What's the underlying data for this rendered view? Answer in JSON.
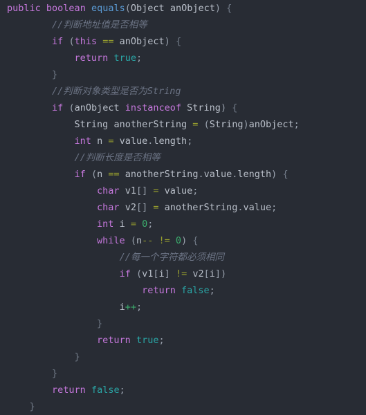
{
  "editor": {
    "language": "Java",
    "background_color": "#282c34",
    "font_size_px": 13.5,
    "line_height_px": 24,
    "theme_colors": {
      "keyword": "#c678dd",
      "function": "#5b9bd5",
      "identifier": "#b9bfc9",
      "operator": "#99a02e",
      "number": "#3cae6e",
      "literal": "#2aa6a6",
      "comment": "#6b7384",
      "brace": "#6f7885"
    },
    "lines": [
      {
        "index": 1,
        "text": "public boolean equals(Object anObject) {",
        "tokens": [
          {
            "t": "public",
            "c": "t-kw"
          },
          {
            "t": " ",
            "c": "t-plain"
          },
          {
            "t": "boolean",
            "c": "t-kw"
          },
          {
            "t": " ",
            "c": "t-plain"
          },
          {
            "t": "equals",
            "c": "t-fn"
          },
          {
            "t": "(",
            "c": "t-punc"
          },
          {
            "t": "Object",
            "c": "t-type"
          },
          {
            "t": " ",
            "c": "t-plain"
          },
          {
            "t": "anObject",
            "c": "t-id"
          },
          {
            "t": ")",
            "c": "t-punc"
          },
          {
            "t": " ",
            "c": "t-plain"
          },
          {
            "t": "{",
            "c": "t-brace"
          }
        ]
      },
      {
        "index": 2,
        "text": "        //判断地址值是否相等",
        "tokens": [
          {
            "t": "        ",
            "c": "t-plain"
          },
          {
            "t": "//判断地址值是否相等",
            "c": "t-cmt"
          }
        ]
      },
      {
        "index": 3,
        "text": "        if (this == anObject) {",
        "tokens": [
          {
            "t": "        ",
            "c": "t-plain"
          },
          {
            "t": "if",
            "c": "t-kw"
          },
          {
            "t": " ",
            "c": "t-plain"
          },
          {
            "t": "(",
            "c": "t-punc"
          },
          {
            "t": "this",
            "c": "t-kw"
          },
          {
            "t": " ",
            "c": "t-plain"
          },
          {
            "t": "==",
            "c": "t-op"
          },
          {
            "t": " ",
            "c": "t-plain"
          },
          {
            "t": "anObject",
            "c": "t-id"
          },
          {
            "t": ")",
            "c": "t-punc"
          },
          {
            "t": " ",
            "c": "t-plain"
          },
          {
            "t": "{",
            "c": "t-brace"
          }
        ]
      },
      {
        "index": 4,
        "text": "            return true;",
        "tokens": [
          {
            "t": "            ",
            "c": "t-plain"
          },
          {
            "t": "return",
            "c": "t-kw"
          },
          {
            "t": " ",
            "c": "t-plain"
          },
          {
            "t": "true",
            "c": "t-lit"
          },
          {
            "t": ";",
            "c": "t-punc"
          }
        ]
      },
      {
        "index": 5,
        "text": "        }",
        "tokens": [
          {
            "t": "        ",
            "c": "t-plain"
          },
          {
            "t": "}",
            "c": "t-brace"
          }
        ]
      },
      {
        "index": 6,
        "text": "        //判断对象类型是否为String",
        "tokens": [
          {
            "t": "        ",
            "c": "t-plain"
          },
          {
            "t": "//判断对象类型是否为String",
            "c": "t-cmt"
          }
        ]
      },
      {
        "index": 7,
        "text": "        if (anObject instanceof String) {",
        "tokens": [
          {
            "t": "        ",
            "c": "t-plain"
          },
          {
            "t": "if",
            "c": "t-kw"
          },
          {
            "t": " ",
            "c": "t-plain"
          },
          {
            "t": "(",
            "c": "t-punc"
          },
          {
            "t": "anObject",
            "c": "t-id"
          },
          {
            "t": " ",
            "c": "t-plain"
          },
          {
            "t": "instanceof",
            "c": "t-kw"
          },
          {
            "t": " ",
            "c": "t-plain"
          },
          {
            "t": "String",
            "c": "t-type"
          },
          {
            "t": ")",
            "c": "t-punc"
          },
          {
            "t": " ",
            "c": "t-plain"
          },
          {
            "t": "{",
            "c": "t-brace"
          }
        ]
      },
      {
        "index": 8,
        "text": "            String anotherString = (String)anObject;",
        "tokens": [
          {
            "t": "            ",
            "c": "t-plain"
          },
          {
            "t": "String",
            "c": "t-type"
          },
          {
            "t": " ",
            "c": "t-plain"
          },
          {
            "t": "anotherString",
            "c": "t-id"
          },
          {
            "t": " ",
            "c": "t-plain"
          },
          {
            "t": "=",
            "c": "t-op"
          },
          {
            "t": " ",
            "c": "t-plain"
          },
          {
            "t": "(",
            "c": "t-punc"
          },
          {
            "t": "String",
            "c": "t-type"
          },
          {
            "t": ")",
            "c": "t-punc"
          },
          {
            "t": "anObject",
            "c": "t-id"
          },
          {
            "t": ";",
            "c": "t-punc"
          }
        ]
      },
      {
        "index": 9,
        "text": "            int n = value.length;",
        "tokens": [
          {
            "t": "            ",
            "c": "t-plain"
          },
          {
            "t": "int",
            "c": "t-kw"
          },
          {
            "t": " ",
            "c": "t-plain"
          },
          {
            "t": "n",
            "c": "t-id"
          },
          {
            "t": " ",
            "c": "t-plain"
          },
          {
            "t": "=",
            "c": "t-op"
          },
          {
            "t": " ",
            "c": "t-plain"
          },
          {
            "t": "value",
            "c": "t-id"
          },
          {
            "t": ".",
            "c": "t-punc"
          },
          {
            "t": "length",
            "c": "t-id"
          },
          {
            "t": ";",
            "c": "t-punc"
          }
        ]
      },
      {
        "index": 10,
        "text": "            //判断长度是否相等",
        "tokens": [
          {
            "t": "            ",
            "c": "t-plain"
          },
          {
            "t": "//判断长度是否相等",
            "c": "t-cmt"
          }
        ]
      },
      {
        "index": 11,
        "text": "            if (n == anotherString.value.length) {",
        "tokens": [
          {
            "t": "            ",
            "c": "t-plain"
          },
          {
            "t": "if",
            "c": "t-kw"
          },
          {
            "t": " ",
            "c": "t-plain"
          },
          {
            "t": "(",
            "c": "t-punc"
          },
          {
            "t": "n",
            "c": "t-id"
          },
          {
            "t": " ",
            "c": "t-plain"
          },
          {
            "t": "==",
            "c": "t-op"
          },
          {
            "t": " ",
            "c": "t-plain"
          },
          {
            "t": "anotherString",
            "c": "t-id"
          },
          {
            "t": ".",
            "c": "t-punc"
          },
          {
            "t": "value",
            "c": "t-id"
          },
          {
            "t": ".",
            "c": "t-punc"
          },
          {
            "t": "length",
            "c": "t-id"
          },
          {
            "t": ")",
            "c": "t-punc"
          },
          {
            "t": " ",
            "c": "t-plain"
          },
          {
            "t": "{",
            "c": "t-brace"
          }
        ]
      },
      {
        "index": 12,
        "text": "                char v1[] = value;",
        "tokens": [
          {
            "t": "                ",
            "c": "t-plain"
          },
          {
            "t": "char",
            "c": "t-kw"
          },
          {
            "t": " ",
            "c": "t-plain"
          },
          {
            "t": "v1",
            "c": "t-id"
          },
          {
            "t": "[]",
            "c": "t-punc"
          },
          {
            "t": " ",
            "c": "t-plain"
          },
          {
            "t": "=",
            "c": "t-op"
          },
          {
            "t": " ",
            "c": "t-plain"
          },
          {
            "t": "value",
            "c": "t-id"
          },
          {
            "t": ";",
            "c": "t-punc"
          }
        ]
      },
      {
        "index": 13,
        "text": "                char v2[] = anotherString.value;",
        "tokens": [
          {
            "t": "                ",
            "c": "t-plain"
          },
          {
            "t": "char",
            "c": "t-kw"
          },
          {
            "t": " ",
            "c": "t-plain"
          },
          {
            "t": "v2",
            "c": "t-id"
          },
          {
            "t": "[]",
            "c": "t-punc"
          },
          {
            "t": " ",
            "c": "t-plain"
          },
          {
            "t": "=",
            "c": "t-op"
          },
          {
            "t": " ",
            "c": "t-plain"
          },
          {
            "t": "anotherString",
            "c": "t-id"
          },
          {
            "t": ".",
            "c": "t-punc"
          },
          {
            "t": "value",
            "c": "t-id"
          },
          {
            "t": ";",
            "c": "t-punc"
          }
        ]
      },
      {
        "index": 14,
        "text": "                int i = 0;",
        "tokens": [
          {
            "t": "                ",
            "c": "t-plain"
          },
          {
            "t": "int",
            "c": "t-kw"
          },
          {
            "t": " ",
            "c": "t-plain"
          },
          {
            "t": "i",
            "c": "t-id"
          },
          {
            "t": " ",
            "c": "t-plain"
          },
          {
            "t": "=",
            "c": "t-op"
          },
          {
            "t": " ",
            "c": "t-plain"
          },
          {
            "t": "0",
            "c": "t-num"
          },
          {
            "t": ";",
            "c": "t-punc"
          }
        ]
      },
      {
        "index": 15,
        "text": "                while (n-- != 0) {",
        "tokens": [
          {
            "t": "                ",
            "c": "t-plain"
          },
          {
            "t": "while",
            "c": "t-kw"
          },
          {
            "t": " ",
            "c": "t-plain"
          },
          {
            "t": "(",
            "c": "t-punc"
          },
          {
            "t": "n",
            "c": "t-id"
          },
          {
            "t": "--",
            "c": "t-op"
          },
          {
            "t": " ",
            "c": "t-plain"
          },
          {
            "t": "!=",
            "c": "t-op"
          },
          {
            "t": " ",
            "c": "t-plain"
          },
          {
            "t": "0",
            "c": "t-num"
          },
          {
            "t": ")",
            "c": "t-punc"
          },
          {
            "t": " ",
            "c": "t-plain"
          },
          {
            "t": "{",
            "c": "t-brace"
          }
        ]
      },
      {
        "index": 16,
        "text": "                    //每一个字符都必须相同",
        "tokens": [
          {
            "t": "                    ",
            "c": "t-plain"
          },
          {
            "t": "//每一个字符都必须相同",
            "c": "t-cmt"
          }
        ]
      },
      {
        "index": 17,
        "text": "                    if (v1[i] != v2[i])",
        "tokens": [
          {
            "t": "                    ",
            "c": "t-plain"
          },
          {
            "t": "if",
            "c": "t-kw"
          },
          {
            "t": " ",
            "c": "t-plain"
          },
          {
            "t": "(",
            "c": "t-punc"
          },
          {
            "t": "v1",
            "c": "t-id"
          },
          {
            "t": "[",
            "c": "t-punc"
          },
          {
            "t": "i",
            "c": "t-id"
          },
          {
            "t": "]",
            "c": "t-punc"
          },
          {
            "t": " ",
            "c": "t-plain"
          },
          {
            "t": "!=",
            "c": "t-op"
          },
          {
            "t": " ",
            "c": "t-plain"
          },
          {
            "t": "v2",
            "c": "t-id"
          },
          {
            "t": "[",
            "c": "t-punc"
          },
          {
            "t": "i",
            "c": "t-id"
          },
          {
            "t": "]",
            "c": "t-punc"
          },
          {
            "t": ")",
            "c": "t-punc"
          }
        ]
      },
      {
        "index": 18,
        "text": "                        return false;",
        "tokens": [
          {
            "t": "                        ",
            "c": "t-plain"
          },
          {
            "t": "return",
            "c": "t-kw"
          },
          {
            "t": " ",
            "c": "t-plain"
          },
          {
            "t": "false",
            "c": "t-lit"
          },
          {
            "t": ";",
            "c": "t-punc"
          }
        ]
      },
      {
        "index": 19,
        "text": "                    i++;",
        "tokens": [
          {
            "t": "                    ",
            "c": "t-plain"
          },
          {
            "t": "i",
            "c": "t-id"
          },
          {
            "t": "++",
            "c": "t-num"
          },
          {
            "t": ";",
            "c": "t-punc"
          }
        ]
      },
      {
        "index": 20,
        "text": "                }",
        "tokens": [
          {
            "t": "                ",
            "c": "t-plain"
          },
          {
            "t": "}",
            "c": "t-brace"
          }
        ]
      },
      {
        "index": 21,
        "text": "                return true;",
        "tokens": [
          {
            "t": "                ",
            "c": "t-plain"
          },
          {
            "t": "return",
            "c": "t-kw"
          },
          {
            "t": " ",
            "c": "t-plain"
          },
          {
            "t": "true",
            "c": "t-lit"
          },
          {
            "t": ";",
            "c": "t-punc"
          }
        ]
      },
      {
        "index": 22,
        "text": "            }",
        "tokens": [
          {
            "t": "            ",
            "c": "t-plain"
          },
          {
            "t": "}",
            "c": "t-brace"
          }
        ]
      },
      {
        "index": 23,
        "text": "        }",
        "tokens": [
          {
            "t": "        ",
            "c": "t-plain"
          },
          {
            "t": "}",
            "c": "t-brace"
          }
        ]
      },
      {
        "index": 24,
        "text": "        return false;",
        "tokens": [
          {
            "t": "        ",
            "c": "t-plain"
          },
          {
            "t": "return",
            "c": "t-kw"
          },
          {
            "t": " ",
            "c": "t-plain"
          },
          {
            "t": "false",
            "c": "t-lit"
          },
          {
            "t": ";",
            "c": "t-punc"
          }
        ]
      },
      {
        "index": 25,
        "text": "    }",
        "tokens": [
          {
            "t": "    ",
            "c": "t-plain"
          },
          {
            "t": "}",
            "c": "t-brace"
          }
        ]
      }
    ]
  }
}
